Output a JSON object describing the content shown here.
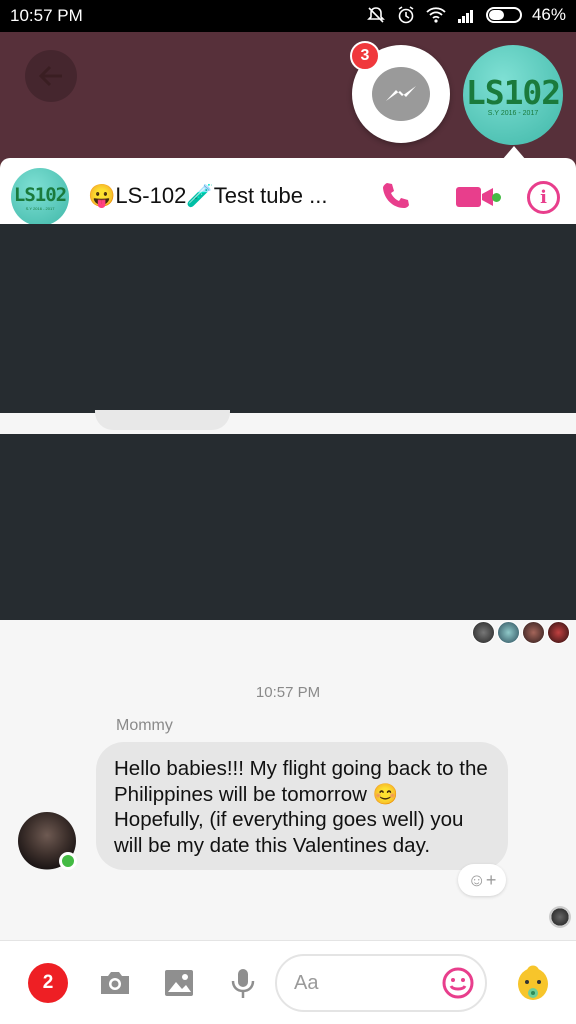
{
  "status_bar": {
    "time": "10:57 PM",
    "battery": "46%",
    "icons": [
      "mute-icon",
      "alarm-icon",
      "wifi-icon",
      "signal-icon",
      "battery-icon"
    ]
  },
  "chat_heads": {
    "messenger_badge": "3",
    "group_logo": "LS102",
    "group_sy": "S.Y 2016 - 2017"
  },
  "header": {
    "avatar_logo": "LS102",
    "avatar_sy": "S.Y 2016 - 2017",
    "title": "😛LS-102🧪Test tube ..."
  },
  "conversation": {
    "timestamp": "10:57 PM",
    "sender": "Mommy",
    "message": "Hello babies!!! My flight going back to the Philippines will be tomorrow 😊 Hopefully, (if everything goes well) you will be my date this Valentines day.",
    "react_label": "☺+"
  },
  "composer": {
    "count_badge": "2",
    "placeholder": "Aa"
  },
  "colors": {
    "accent": "#e83e8c",
    "online": "#44bb44",
    "badge": "#ee1f24",
    "redaction": "#262c30"
  }
}
